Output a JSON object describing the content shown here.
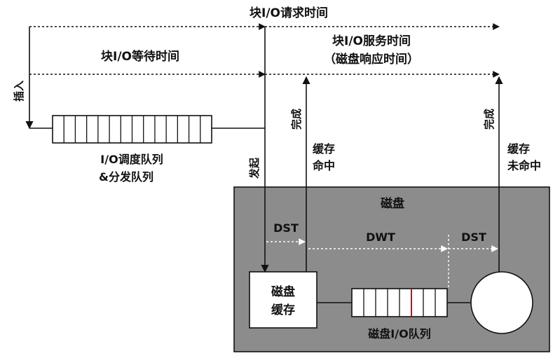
{
  "labels": {
    "request_time": "块I/O请求时间",
    "service_time_line1": "块I/O服务时间",
    "service_time_line2": "（磁盘响应时间）",
    "wait_time": "块I/O等待时间",
    "insert": "插入",
    "sched_queue_line1": "I/O调度队列",
    "sched_queue_line2": "&分发队列",
    "issue": "发起",
    "complete_left": "完成",
    "cache_hit_line1": "缓存",
    "cache_hit_line2": "命中",
    "complete_right": "完成",
    "cache_miss_line1": "缓存",
    "cache_miss_line2": "未命中",
    "disk": "磁盘",
    "dst_left": "DST",
    "dwt": "DWT",
    "dst_right": "DST",
    "disk_cache_line1": "磁盘",
    "disk_cache_line2": "缓存",
    "disk_io_queue": "磁盘I/O队列"
  },
  "colors": {
    "disk_box": "#8c8c8c",
    "queue_red_cell": "#d40000",
    "stroke": "#111111"
  }
}
